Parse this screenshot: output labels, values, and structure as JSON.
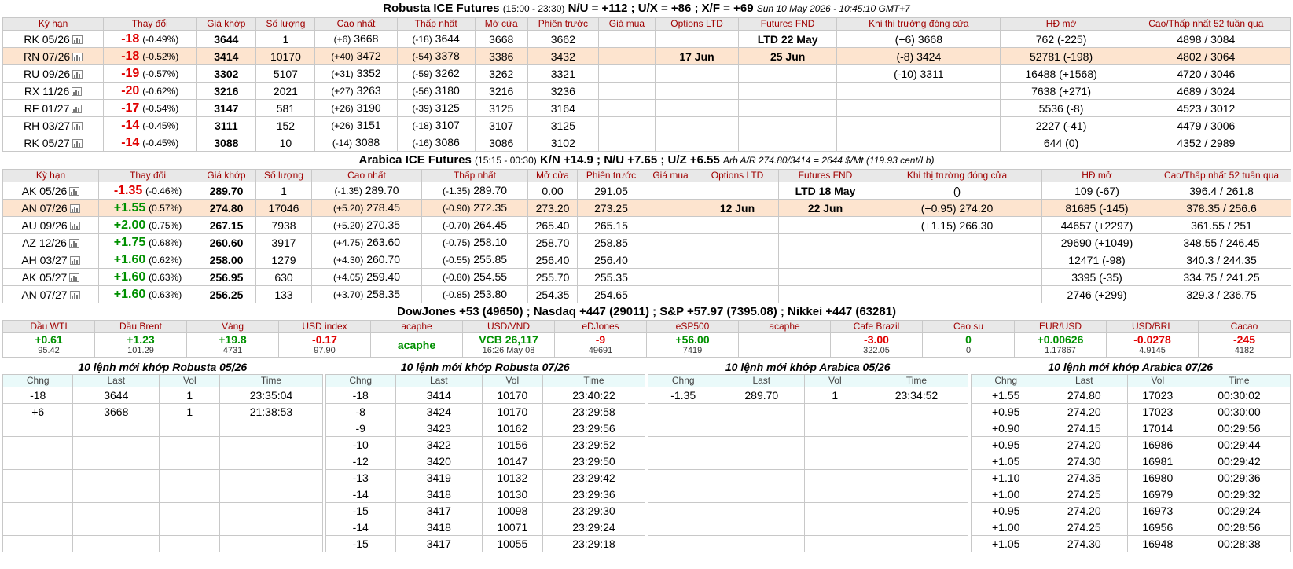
{
  "robusta": {
    "title": "Robusta ICE Futures",
    "hours": "(15:00 - 23:30)",
    "spreads": "N/U = +112 ; U/X = +86 ; X/F = +69",
    "datetime": "Sun 10 May 2026 - 10:45:10 GMT+7",
    "headers": [
      "Kỳ hạn",
      "Thay đổi",
      "Giá khớp",
      "Số lượng",
      "Cao nhất",
      "Thấp nhất",
      "Mở cửa",
      "Phiên trước",
      "Giá mua",
      "Options LTD",
      "Futures FND",
      "Khi thị trường đóng cửa",
      "HĐ mở",
      "Cao/Thấp nhất 52 tuần qua"
    ],
    "rows": [
      {
        "sym": "RK 05/26",
        "chg": "-18",
        "pct": "(-0.49%)",
        "price": "3644",
        "vol": "1",
        "high_c": "(+6)",
        "high": "3668",
        "low_c": "(-18)",
        "low": "3644",
        "open": "3668",
        "prev": "3662",
        "bid": "",
        "opt": "",
        "fnd": "LTD 22 May",
        "close": "(+6) 3668",
        "oi": "762 (-225)",
        "hl52": "4898 / 3084"
      },
      {
        "sym": "RN 07/26",
        "chg": "-18",
        "pct": "(-0.52%)",
        "price": "3414",
        "vol": "10170",
        "high_c": "(+40)",
        "high": "3472",
        "low_c": "(-54)",
        "low": "3378",
        "open": "3386",
        "prev": "3432",
        "bid": "",
        "opt": "17 Jun",
        "fnd": "25 Jun",
        "close": "(-8) 3424",
        "oi": "52781 (-198)",
        "hl52": "4802 / 3064"
      },
      {
        "sym": "RU 09/26",
        "chg": "-19",
        "pct": "(-0.57%)",
        "price": "3302",
        "vol": "5107",
        "high_c": "(+31)",
        "high": "3352",
        "low_c": "(-59)",
        "low": "3262",
        "open": "3262",
        "prev": "3321",
        "bid": "",
        "opt": "",
        "fnd": "",
        "close": "(-10) 3311",
        "oi": "16488 (+1568)",
        "hl52": "4720 / 3046"
      },
      {
        "sym": "RX 11/26",
        "chg": "-20",
        "pct": "(-0.62%)",
        "price": "3216",
        "vol": "2021",
        "high_c": "(+27)",
        "high": "3263",
        "low_c": "(-56)",
        "low": "3180",
        "open": "3216",
        "prev": "3236",
        "bid": "",
        "opt": "",
        "fnd": "",
        "close": "",
        "oi": "7638 (+271)",
        "hl52": "4689 / 3024"
      },
      {
        "sym": "RF 01/27",
        "chg": "-17",
        "pct": "(-0.54%)",
        "price": "3147",
        "vol": "581",
        "high_c": "(+26)",
        "high": "3190",
        "low_c": "(-39)",
        "low": "3125",
        "open": "3125",
        "prev": "3164",
        "bid": "",
        "opt": "",
        "fnd": "",
        "close": "",
        "oi": "5536 (-8)",
        "hl52": "4523 / 3012"
      },
      {
        "sym": "RH 03/27",
        "chg": "-14",
        "pct": "(-0.45%)",
        "price": "3111",
        "vol": "152",
        "high_c": "(+26)",
        "high": "3151",
        "low_c": "(-18)",
        "low": "3107",
        "open": "3107",
        "prev": "3125",
        "bid": "",
        "opt": "",
        "fnd": "",
        "close": "",
        "oi": "2227 (-41)",
        "hl52": "4479 / 3006"
      },
      {
        "sym": "RK 05/27",
        "chg": "-14",
        "pct": "(-0.45%)",
        "price": "3088",
        "vol": "10",
        "high_c": "(-14)",
        "high": "3088",
        "low_c": "(-16)",
        "low": "3086",
        "open": "3086",
        "prev": "3102",
        "bid": "",
        "opt": "",
        "fnd": "",
        "close": "",
        "oi": "644 (0)",
        "hl52": "4352 / 2989"
      }
    ]
  },
  "arabica": {
    "title": "Arabica ICE Futures",
    "hours": "(15:15 - 00:30)",
    "spreads": "K/N +14.9 ; N/U +7.65 ; U/Z +6.55",
    "arb": "Arb A/R 274.80/3414 = 2644 $/Mt (119.93 cent/Lb)",
    "headers": [
      "Kỳ hạn",
      "Thay đổi",
      "Giá khớp",
      "Số lượng",
      "Cao nhất",
      "Thấp nhất",
      "Mở cửa",
      "Phiên trước",
      "Giá mua",
      "Options LTD",
      "Futures FND",
      "Khi thị trường đóng cửa",
      "HĐ mở",
      "Cao/Thấp nhất 52 tuần qua"
    ],
    "rows": [
      {
        "sym": "AK 05/26",
        "chg": "-1.35",
        "pct": "(-0.46%)",
        "price": "289.70",
        "vol": "1",
        "high_c": "(-1.35)",
        "high": "289.70",
        "low_c": "(-1.35)",
        "low": "289.70",
        "open": "0.00",
        "prev": "291.05",
        "bid": "",
        "opt": "",
        "fnd": "LTD 18 May",
        "close": "()",
        "oi": "109 (-67)",
        "hl52": "396.4 / 261.8"
      },
      {
        "sym": "AN 07/26",
        "chg": "+1.55",
        "pct": "(0.57%)",
        "price": "274.80",
        "vol": "17046",
        "high_c": "(+5.20)",
        "high": "278.45",
        "low_c": "(-0.90)",
        "low": "272.35",
        "open": "273.20",
        "prev": "273.25",
        "bid": "",
        "opt": "12 Jun",
        "fnd": "22 Jun",
        "close": "(+0.95) 274.20",
        "oi": "81685 (-145)",
        "hl52": "378.35 / 256.6"
      },
      {
        "sym": "AU 09/26",
        "chg": "+2.00",
        "pct": "(0.75%)",
        "price": "267.15",
        "vol": "7938",
        "high_c": "(+5.20)",
        "high": "270.35",
        "low_c": "(-0.70)",
        "low": "264.45",
        "open": "265.40",
        "prev": "265.15",
        "bid": "",
        "opt": "",
        "fnd": "",
        "close": "(+1.15) 266.30",
        "oi": "44657 (+2297)",
        "hl52": "361.55 / 251"
      },
      {
        "sym": "AZ 12/26",
        "chg": "+1.75",
        "pct": "(0.68%)",
        "price": "260.60",
        "vol": "3917",
        "high_c": "(+4.75)",
        "high": "263.60",
        "low_c": "(-0.75)",
        "low": "258.10",
        "open": "258.70",
        "prev": "258.85",
        "bid": "",
        "opt": "",
        "fnd": "",
        "close": "",
        "oi": "29690 (+1049)",
        "hl52": "348.55 / 246.45"
      },
      {
        "sym": "AH 03/27",
        "chg": "+1.60",
        "pct": "(0.62%)",
        "price": "258.00",
        "vol": "1279",
        "high_c": "(+4.30)",
        "high": "260.70",
        "low_c": "(-0.55)",
        "low": "255.85",
        "open": "256.40",
        "prev": "256.40",
        "bid": "",
        "opt": "",
        "fnd": "",
        "close": "",
        "oi": "12471 (-98)",
        "hl52": "340.3 / 244.35"
      },
      {
        "sym": "AK 05/27",
        "chg": "+1.60",
        "pct": "(0.63%)",
        "price": "256.95",
        "vol": "630",
        "high_c": "(+4.05)",
        "high": "259.40",
        "low_c": "(-0.80)",
        "low": "254.55",
        "open": "255.70",
        "prev": "255.35",
        "bid": "",
        "opt": "",
        "fnd": "",
        "close": "",
        "oi": "3395 (-35)",
        "hl52": "334.75 / 241.25"
      },
      {
        "sym": "AN 07/27",
        "chg": "+1.60",
        "pct": "(0.63%)",
        "price": "256.25",
        "vol": "133",
        "high_c": "(+3.70)",
        "high": "258.35",
        "low_c": "(-0.85)",
        "low": "253.80",
        "open": "254.35",
        "prev": "254.65",
        "bid": "",
        "opt": "",
        "fnd": "",
        "close": "",
        "oi": "2746 (+299)",
        "hl52": "329.3 / 236.75"
      }
    ]
  },
  "indices_title": "DowJones +53 (49650) ; Nasdaq +447 (29011) ; S&P +57.97 (7395.08) ; Nikkei +447 (63281)",
  "market": [
    {
      "head": "Dầu WTI",
      "main": "+0.61",
      "sub": "95.42",
      "tone": "green"
    },
    {
      "head": "Dầu Brent",
      "main": "+1.23",
      "sub": "101.29",
      "tone": "green"
    },
    {
      "head": "Vàng",
      "main": "+19.8",
      "sub": "4731",
      "tone": "green"
    },
    {
      "head": "USD index",
      "main": "-0.17",
      "sub": "97.90",
      "tone": "red"
    },
    {
      "head": "acaphe",
      "main": "acaphe",
      "sub": "",
      "tone": "green"
    },
    {
      "head": "USD/VND",
      "main": "VCB 26,117",
      "sub": "16:26 May 08",
      "tone": "green"
    },
    {
      "head": "eDJones",
      "main": "-9",
      "sub": "49691",
      "tone": "red"
    },
    {
      "head": "eSP500",
      "main": "+56.00",
      "sub": "7419",
      "tone": "green"
    },
    {
      "head": "acaphe",
      "main": "",
      "sub": "",
      "tone": "green"
    },
    {
      "head": "Cafe Brazil",
      "main": "-3.00",
      "sub": "322.05",
      "tone": "red"
    },
    {
      "head": "Cao su",
      "main": "0",
      "sub": "0",
      "tone": "green"
    },
    {
      "head": "EUR/USD",
      "main": "+0.00626",
      "sub": "1.17867",
      "tone": "green"
    },
    {
      "head": "USD/BRL",
      "main": "-0.0278",
      "sub": "4.9145",
      "tone": "red"
    },
    {
      "head": "Cacao",
      "main": "-245",
      "sub": "4182",
      "tone": "red"
    }
  ],
  "trade_headers": [
    "Chng",
    "Last",
    "Vol",
    "Time"
  ],
  "trades": [
    {
      "title": "10 lệnh mới khớp Robusta 05/26",
      "rows": [
        [
          "-18",
          "3644",
          "1",
          "23:35:04"
        ],
        [
          "+6",
          "3668",
          "1",
          "21:38:53"
        ]
      ]
    },
    {
      "title": "10 lệnh mới khớp Robusta 07/26",
      "rows": [
        [
          "-18",
          "3414",
          "10170",
          "23:40:22"
        ],
        [
          "-8",
          "3424",
          "10170",
          "23:29:58"
        ],
        [
          "-9",
          "3423",
          "10162",
          "23:29:56"
        ],
        [
          "-10",
          "3422",
          "10156",
          "23:29:52"
        ],
        [
          "-12",
          "3420",
          "10147",
          "23:29:50"
        ],
        [
          "-13",
          "3419",
          "10132",
          "23:29:42"
        ],
        [
          "-14",
          "3418",
          "10130",
          "23:29:36"
        ],
        [
          "-15",
          "3417",
          "10098",
          "23:29:30"
        ],
        [
          "-14",
          "3418",
          "10071",
          "23:29:24"
        ],
        [
          "-15",
          "3417",
          "10055",
          "23:29:18"
        ]
      ]
    },
    {
      "title": "10 lệnh mới khớp Arabica 05/26",
      "rows": [
        [
          "-1.35",
          "289.70",
          "1",
          "23:34:52"
        ]
      ]
    },
    {
      "title": "10 lệnh mới khớp Arabica 07/26",
      "rows": [
        [
          "+1.55",
          "274.80",
          "17023",
          "00:30:02"
        ],
        [
          "+0.95",
          "274.20",
          "17023",
          "00:30:00"
        ],
        [
          "+0.90",
          "274.15",
          "17014",
          "00:29:56"
        ],
        [
          "+0.95",
          "274.20",
          "16986",
          "00:29:44"
        ],
        [
          "+1.05",
          "274.30",
          "16981",
          "00:29:42"
        ],
        [
          "+1.10",
          "274.35",
          "16980",
          "00:29:36"
        ],
        [
          "+1.00",
          "274.25",
          "16979",
          "00:29:32"
        ],
        [
          "+0.95",
          "274.20",
          "16973",
          "00:29:24"
        ],
        [
          "+1.00",
          "274.25",
          "16956",
          "00:28:56"
        ],
        [
          "+1.05",
          "274.30",
          "16948",
          "00:28:38"
        ]
      ]
    }
  ]
}
